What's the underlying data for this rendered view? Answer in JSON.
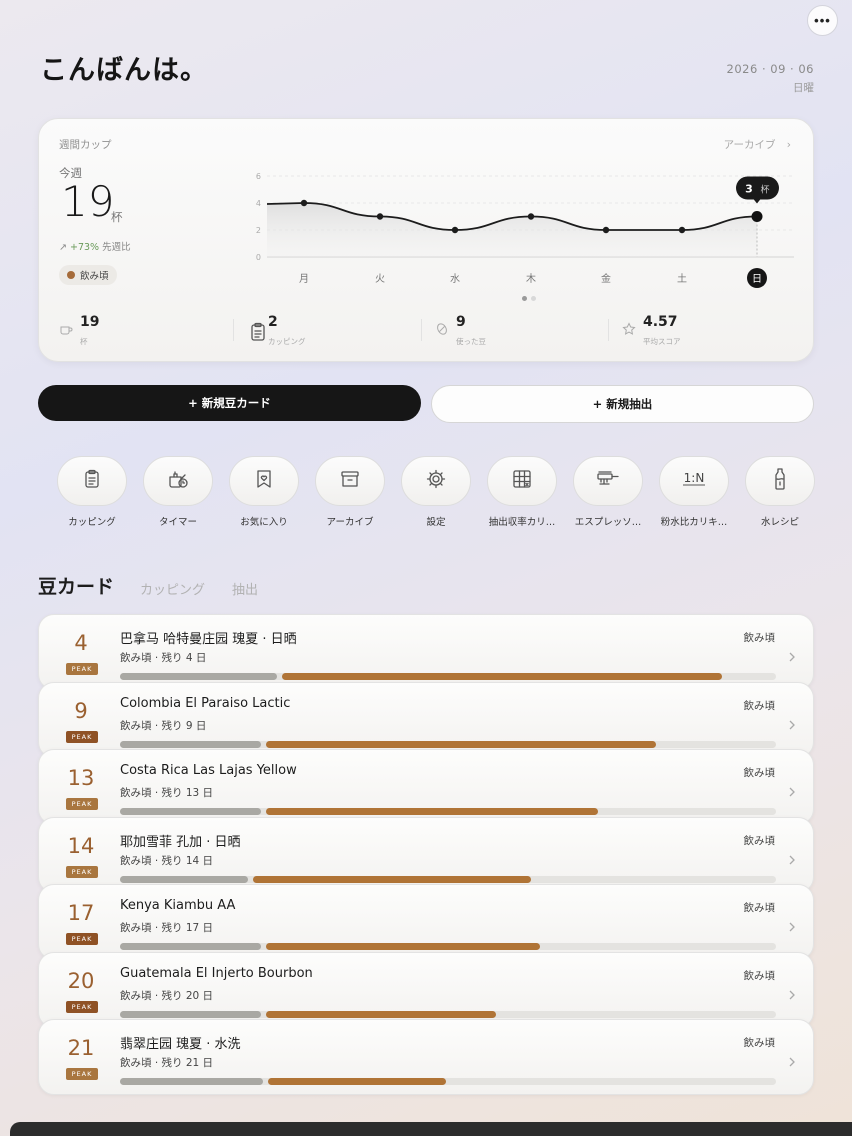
{
  "header": {
    "greeting": "こんばんは。",
    "date": "2026 · 09 · 06",
    "weekday": "日曜",
    "more_icon": "ellipsis-icon"
  },
  "weekly": {
    "card_label": "週間カップ",
    "archive_link": "アーカイブ",
    "this_week_label": "今週",
    "cups_value": "19",
    "cups_unit": "杯",
    "trend_value": "+73%",
    "trend_label": "先週比",
    "status": "飲み頃",
    "tooltip_value": "3",
    "tooltip_unit": "杯"
  },
  "chart_data": {
    "type": "area",
    "categories": [
      "月",
      "火",
      "水",
      "木",
      "金",
      "土",
      "日"
    ],
    "values": [
      4,
      3,
      2,
      3,
      2,
      2,
      3
    ],
    "ylim": [
      0,
      6
    ],
    "yticks": [
      "0",
      "2",
      "4",
      "6"
    ],
    "highlighted": "日",
    "grid": true
  },
  "stats": [
    {
      "value": "19",
      "label": "杯",
      "icon": "cup-icon"
    },
    {
      "value": "2",
      "label": "カッピング",
      "icon": "clipboard-icon"
    },
    {
      "value": "9",
      "label": "使った豆",
      "icon": "bean-icon"
    },
    {
      "value": "4.57",
      "label": "平均スコア",
      "icon": "star-icon"
    }
  ],
  "actions": {
    "new_bean": "+ 新規豆カード",
    "new_brew": "+ 新規抽出"
  },
  "tools": [
    {
      "label": "カッピング",
      "icon": "clipboard-icon"
    },
    {
      "label": "タイマー",
      "icon": "kettle-timer-icon"
    },
    {
      "label": "お気に入り",
      "icon": "bookmark-heart-icon"
    },
    {
      "label": "アーカイブ",
      "icon": "archive-box-icon"
    },
    {
      "label": "設定",
      "icon": "gear-icon"
    },
    {
      "label": "抽出収率カリ…",
      "icon": "grid-calculator-icon"
    },
    {
      "label": "エスプレッソ…",
      "icon": "portafilter-icon"
    },
    {
      "label": "粉水比カリキ…",
      "icon": "ratio-icon",
      "glyph": "1:N"
    },
    {
      "label": "水レシピ",
      "icon": "bottle-icon"
    }
  ],
  "section": {
    "title": "豆カード",
    "tabs": [
      "カッピング",
      "抽出"
    ]
  },
  "bean_cards": [
    {
      "days": "4",
      "badge": "PEAK",
      "badge_color": "#a9763f",
      "name": "巴拿马 哈特曼庄园 瑰夏 · 日晒",
      "sub": "飲み頃 · 残り 4 日",
      "state": "飲み頃",
      "rest": 0.24,
      "fill": 0.67
    },
    {
      "days": "9",
      "badge": "PEAK",
      "badge_color": "#8f5225",
      "name": "Colombia El Paraiso Lactic",
      "sub": "飲み頃 · 残り 9 日",
      "state": "飲み頃",
      "rest": 0.215,
      "fill": 0.595
    },
    {
      "days": "13",
      "badge": "PEAK",
      "badge_color": "#a9763f",
      "name": "Costa Rica Las Lajas Yellow",
      "sub": "飲み頃 · 残り 13 日",
      "state": "飲み頃",
      "rest": 0.215,
      "fill": 0.506
    },
    {
      "days": "14",
      "badge": "PEAK",
      "badge_color": "#a9763f",
      "name": "耶加雪菲 孔加 · 日晒",
      "sub": "飲み頃 · 残り 14 日",
      "state": "飲み頃",
      "rest": 0.195,
      "fill": 0.424
    },
    {
      "days": "17",
      "badge": "PEAK",
      "badge_color": "#8f5225",
      "name": "Kenya Kiambu AA",
      "sub": "飲み頃 · 残り 17 日",
      "state": "飲み頃",
      "rest": 0.215,
      "fill": 0.418
    },
    {
      "days": "20",
      "badge": "PEAK",
      "badge_color": "#8f5225",
      "name": "Guatemala El Injerto Bourbon",
      "sub": "飲み頃 · 残り 20 日",
      "state": "飲み頃",
      "rest": 0.215,
      "fill": 0.351
    },
    {
      "days": "21",
      "badge": "PEAK",
      "badge_color": "#a9763f",
      "name": "翡翠庄园 瑰夏 · 水洗",
      "sub": "飲み頃 · 残り 21 日",
      "state": "飲み頃",
      "rest": 0.218,
      "fill": 0.271
    }
  ]
}
